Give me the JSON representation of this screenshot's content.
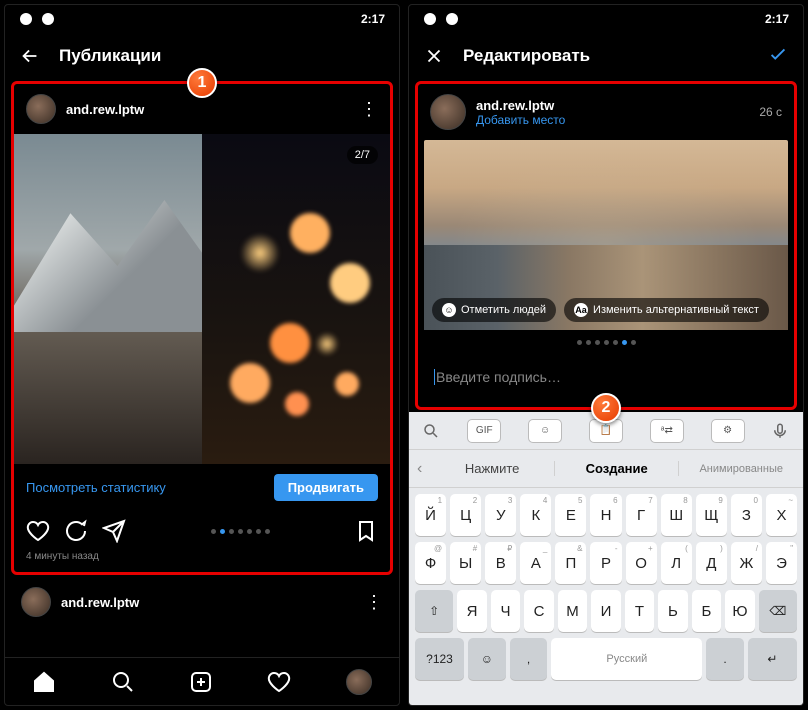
{
  "status": {
    "time": "2:17"
  },
  "left": {
    "header_title": "Публикации",
    "username": "and.rew.lptw",
    "counter": "2/7",
    "stats_link": "Посмотреть статистику",
    "promote": "Продвигать",
    "timestamp": "4 минуты назад"
  },
  "right": {
    "header_title": "Редактировать",
    "username": "and.rew.lptw",
    "add_location": "Добавить место",
    "age": "26 с",
    "tag_people": "Отметить людей",
    "alt_text": "Изменить альтернативный текст",
    "caption_placeholder": "Введите подпись…"
  },
  "keyboard": {
    "toolbar": {
      "gif": "GIF"
    },
    "suggest": {
      "left": "Нажмите",
      "center": "Создание",
      "right": "Анимированные"
    },
    "row1": [
      "Й",
      "Ц",
      "У",
      "К",
      "Е",
      "Н",
      "Г",
      "Ш",
      "Щ",
      "З",
      "Х"
    ],
    "row1_hints": [
      "1",
      "2",
      "3",
      "4",
      "5",
      "6",
      "7",
      "8",
      "9",
      "0",
      "~"
    ],
    "row2": [
      "Ф",
      "Ы",
      "В",
      "А",
      "П",
      "Р",
      "О",
      "Л",
      "Д",
      "Ж",
      "Э"
    ],
    "row2_hints": [
      "@",
      "#",
      "₽",
      "_",
      "&",
      "-",
      "+",
      "(",
      ")",
      "/",
      "\""
    ],
    "row3": [
      "Я",
      "Ч",
      "С",
      "М",
      "И",
      "Т",
      "Ь",
      "Б",
      "Ю"
    ],
    "fn": {
      "shift": "⇧",
      "bksp": "⌫",
      "num": "?123",
      "lang": "Русский",
      "enter": "↵"
    }
  },
  "badges": {
    "one": "1",
    "two": "2"
  }
}
